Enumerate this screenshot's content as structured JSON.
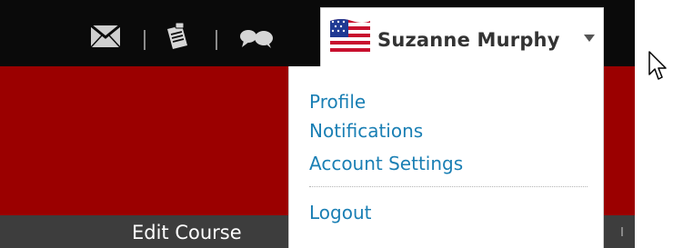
{
  "header": {
    "icons": [
      {
        "name": "mail-icon"
      },
      {
        "name": "assignment-icon"
      },
      {
        "name": "discussion-icon"
      }
    ],
    "user": {
      "name": "Suzanne Murphy",
      "avatar": "us-flag-avatar"
    }
  },
  "user_menu": {
    "items": [
      {
        "label": "Profile"
      },
      {
        "label": "Notifications"
      },
      {
        "label": "Account Settings"
      }
    ],
    "logout_label": "Logout"
  },
  "footer": {
    "edit_course_label": "Edit Course"
  },
  "colors": {
    "topbar": "#0a0a0a",
    "banner": "#9b0000",
    "link": "#1a7fb4",
    "bottombar": "#3d3d3d"
  }
}
